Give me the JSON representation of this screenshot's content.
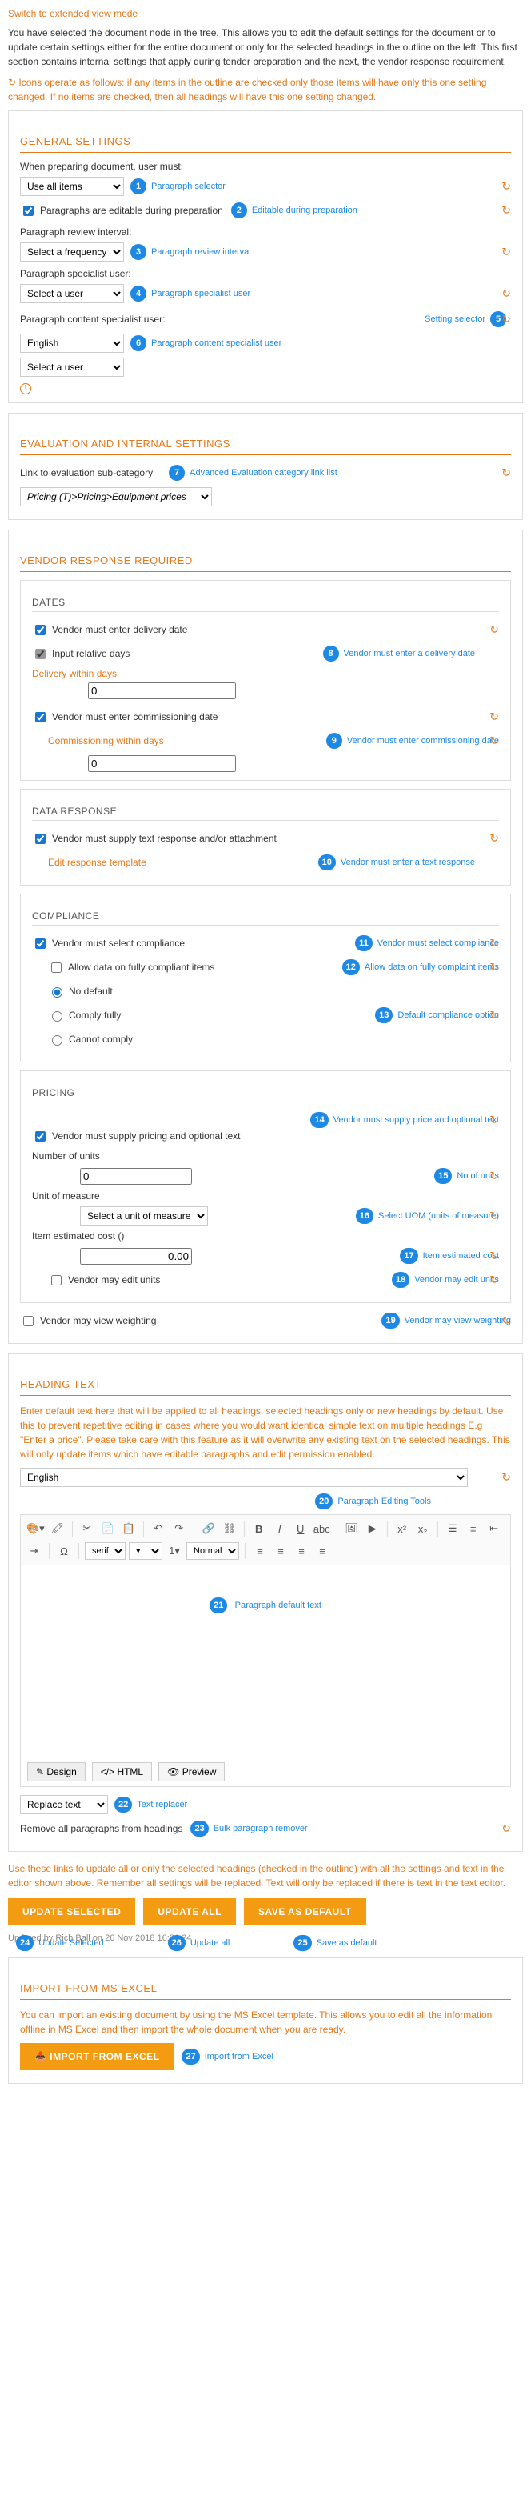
{
  "top_link": "Switch to extended view mode",
  "intro_text": "You have selected the document node in the tree. This allows you to edit the default settings for the document or to update certain settings either for the entire document or only for the selected headings in the outline on the left. This first section contains internal settings that apply during tender preparation and the next, the vendor response requirement.",
  "refresh_note": "↻ Icons operate as follows: if any items in the outline are checked only those items will have only this one setting changed. If no items are checked, then all headings will have this one setting changed.",
  "general": {
    "title": "GENERAL SETTINGS",
    "prepare_label": "When preparing document, user must:",
    "prepare_value": "Use all items",
    "ann1": "Paragraph selector",
    "editable_label": "Paragraphs are editable during preparation",
    "ann2": "Editable during preparation",
    "review_interval_label": "Paragraph review interval:",
    "review_interval_value": "Select a frequency",
    "ann3": "Paragraph review interval",
    "specialist_label": "Paragraph specialist user:",
    "specialist_value": "Select a user",
    "ann4": "Paragraph specialist user",
    "content_specialist_label": "Paragraph content specialist user:",
    "setting_selector": "Setting selector",
    "language_value": "English",
    "ann6": "Paragraph content specialist user",
    "user_value": "Select a user"
  },
  "evaluation": {
    "title": "EVALUATION AND INTERNAL SETTINGS",
    "link_label": "Link to evaluation sub-category",
    "ann7": "Advanced Evaluation category link list",
    "link_value": "Pricing (T)>Pricing>Equipment prices"
  },
  "vendor": {
    "title": "VENDOR RESPONSE REQUIRED",
    "dates": {
      "title": "DATES",
      "delivery_check": "Vendor must enter delivery date",
      "relative_days": "Input relative days",
      "ann8": "Vendor must enter a delivery date",
      "delivery_within": "Delivery within days",
      "delivery_value": "0",
      "commissioning_check": "Vendor must enter commissioning date",
      "commissioning_within": "Commissioning within days",
      "ann9": "Vendor must enter commissioning date",
      "commissioning_value": "0"
    },
    "data_response": {
      "title": "DATA RESPONSE",
      "text_check": "Vendor must supply text response and/or attachment",
      "edit_template": "Edit response template",
      "ann10": "Vendor must enter a text response"
    },
    "compliance": {
      "title": "COMPLIANCE",
      "select_check": "Vendor must select compliance",
      "ann11": "Vendor must select compliance",
      "allow_data": "Allow data on fully compliant items",
      "ann12": "Allow data on fully complaint items",
      "no_default": "No default",
      "ann13": "Default compliance option",
      "comply_fully": "Comply fully",
      "cannot_comply": "Cannot comply"
    },
    "pricing": {
      "title": "PRICING",
      "ann14": "Vendor must supply price and optional text",
      "price_check": "Vendor must supply pricing and optional text",
      "units_label": "Number of units",
      "units_value": "0",
      "ann15": "No of units",
      "uom_label": "Unit of measure",
      "uom_value": "Select a unit of measure",
      "ann16": "Select UOM (units of measure)",
      "cost_label": "Item estimated cost ()",
      "cost_value": "0.00",
      "ann17": "Item estimated cost",
      "edit_units": "Vendor may edit units",
      "ann18": "Vendor may edit units"
    },
    "weighting": "Vendor may view weighting",
    "ann19": "Vendor may view weighting"
  },
  "heading_text": {
    "title": "HEADING TEXT",
    "intro": "Enter default text here that will be applied to all headings, selected headings only or new headings by default. Use this to prevent repetitive editing in cases where you would want identical simple text on multiple headings E.g \"Enter a price\". Please take care with this feature as it will overwrite any existing text on the selected headings. This will only update items which have editable paragraphs and edit permission enabled.",
    "language": "English",
    "ann20": "Paragraph Editing Tools",
    "ann21": "Paragraph default text",
    "toolbar": {
      "font": "serif",
      "size": "1▾",
      "style": "Normal"
    },
    "modes": {
      "design": "Design",
      "html": "HTML",
      "preview": "Preview"
    },
    "replace_label": "Replace text",
    "ann22": "Text replacer",
    "remove_label": "Remove all paragraphs from headings",
    "ann23": "Bulk paragraph remover"
  },
  "update_note": "Use these links to update all or only the selected headings (checked in the outline) with all the settings and text in the editor shown above. Remember all settings will be replaced. Text will only be replaced if there is text in the text editor.",
  "buttons": {
    "update_selected": "UPDATE SELECTED",
    "update_all": "UPDATE ALL",
    "save_default": "SAVE AS DEFAULT",
    "ann24": "Update Selected",
    "ann26": "Update all",
    "ann25": "Save as default"
  },
  "timestamp": "Updated by Rich Ball on 26 Nov 2018 16:31:24",
  "import": {
    "title": "IMPORT FROM MS EXCEL",
    "text": "You can import an existing document by using the MS Excel template. This allows you to edit all the information offline in MS Excel and then import the whole document when you are ready.",
    "button": "IMPORT FROM EXCEL",
    "ann27": "Import from Excel"
  }
}
